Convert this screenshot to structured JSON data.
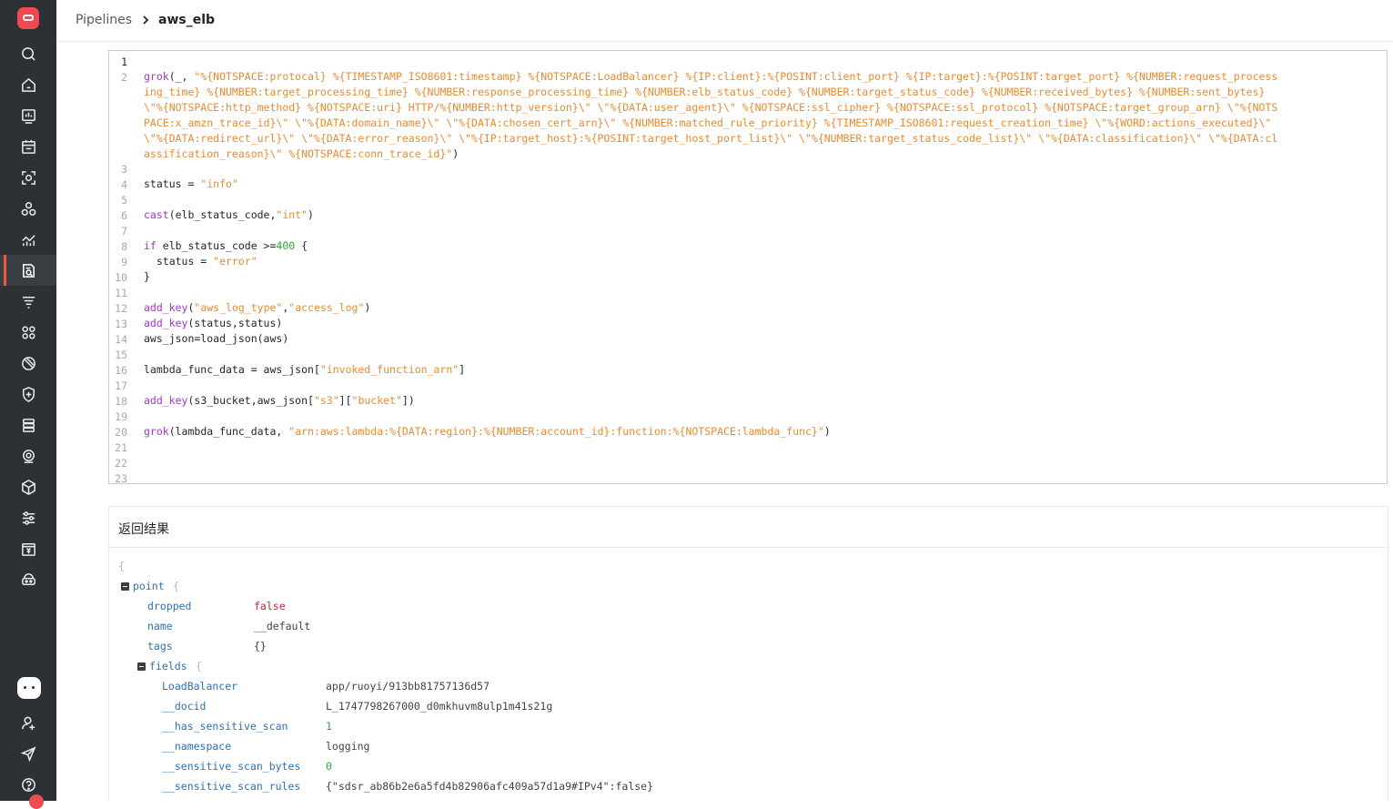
{
  "breadcrumb": {
    "root": "Pipelines",
    "current": "aws_elb"
  },
  "sidebar": {
    "active_item": "pipelines-icon",
    "icons": [
      "search-icon",
      "home-icon",
      "dashboard-icon",
      "calendar-icon",
      "scan-icon",
      "topology-icon",
      "metrics-icon",
      "pipelines-icon",
      "filter-icon",
      "apps-icon",
      "security-icon",
      "shield-icon",
      "database-icon",
      "monitor-icon",
      "package-icon",
      "settings-icon",
      "billing-icon",
      "integration-icon",
      "ai-assistant-icon",
      "user-icon",
      "send-icon",
      "help-icon"
    ]
  },
  "editor": {
    "line_numbers": [
      "1",
      "2",
      "3",
      "4",
      "5",
      "6",
      "7",
      "8",
      "9",
      "10",
      "11",
      "12",
      "13",
      "14",
      "15",
      "16",
      "17",
      "18",
      "19",
      "20",
      "21",
      "22",
      "23"
    ],
    "line2_text": "grok(_, \"%{NOTSPACE:protocal} %{TIMESTAMP_ISO8601:timestamp} %{NOTSPACE:LoadBalancer} %{IP:client}:%{POSINT:client_port} %{IP:target}:%{POSINT:target_port} %{NUMBER:request_processing_time} %{NUMBER:target_processing_time} %{NUMBER:response_processing_time} %{NUMBER:elb_status_code} %{NUMBER:target_status_code} %{NUMBER:received_bytes} %{NUMBER:sent_bytes} \\\"%{NOTSPACE:http_method} %{NOTSPACE:uri} HTTP/%{NUMBER:http_version}\\\" \\\"%{DATA:user_agent}\\\" %{NOTSPACE:ssl_cipher} %{NOTSPACE:ssl_protocol} %{NOTSPACE:target_group_arn} \\\"%{NOTSPACE:x_amzn_trace_id}\\\" \\\"%{DATA:domain_name}\\\" \\\"%{DATA:chosen_cert_arn}\\\" %{NUMBER:matched_rule_priority} %{TIMESTAMP_ISO8601:request_creation_time} \\\"%{WORD:actions_executed}\\\" \\\"%{DATA:redirect_url}\\\" \\\"%{DATA:error_reason}\\\" \\\"%{IP:target_host}:%{POSINT:target_host_port_list}\\\" \\\"%{NUMBER:target_status_code_list}\\\" \\\"%{DATA:classification}\\\" \\\"%{DATA:classification_reason}\\\" %{NOTSPACE:conn_trace_id}\")",
    "line2_wrapped": [
      "%{NOTSPACE:protocal} %{TIMESTAMP_ISO8601:timestamp} %{NOTSPACE:LoadBalancer} %{IP:client}:%{POSINT:client_port} %{IP:target}:%{POSINT:target_port} %{NUMBER:request_process",
      "ing_time} %{NUMBER:target_processing_time} %{NUMBER:response_processing_time} %{NUMBER:elb_status_code} %{NUMBER:target_status_code} %{NUMBER:received_bytes} %{NUMBER:sent_bytes}",
      "\\\"%{NOTSPACE:http_method} %{NOTSPACE:uri} HTTP/%{NUMBER:http_version}\\\" \\\"%{DATA:user_agent}\\\" %{NOTSPACE:ssl_cipher} %{NOTSPACE:ssl_protocol} %{NOTSPACE:target_group_arn} \\\"%{NOTS",
      "PACE:x_amzn_trace_id}\\\" \\\"%{DATA:domain_name}\\\" \\\"%{DATA:chosen_cert_arn}\\\" %{NUMBER:matched_rule_priority} %{TIMESTAMP_ISO8601:request_creation_time} \\\"%{WORD:actions_executed}\\\"",
      "\\\"%{DATA:redirect_url}\\\" \\\"%{DATA:error_reason}\\\" \\\"%{IP:target_host}:%{POSINT:target_host_port_list}\\\" \\\"%{NUMBER:target_status_code_list}\\\" \\\"%{DATA:classification}\\\" \\\"%{DATA:cl",
      "assification_reason}\\\" %{NOTSPACE:conn_trace_id}"
    ],
    "tokens": {
      "grok": "grok",
      "cast": "cast",
      "if": "if",
      "add_key": "add_key",
      "status_var": "status",
      "eq": " = ",
      "info": "\"info\"",
      "error": "\"error\"",
      "int": "\"int\"",
      "elb_status_code": "elb_status_code",
      "n400": "400",
      "aws_log_type": "\"aws_log_type\"",
      "access_log": "\"access_log\"",
      "aws_json_line": "aws_json=load_json(aws)",
      "lambda_var": "lambda_func_data = aws_json[",
      "invoked_function_arn": "\"invoked_function_arn\"",
      "s3": "\"s3\"",
      "bucket": "\"bucket\"",
      "arn_pattern": "\"arn:aws:lambda:%{DATA:region}:%{NUMBER:account_id}:function:%{NOTSPACE:lambda_func}\""
    }
  },
  "result": {
    "title": "返回结果",
    "point_key": "point",
    "fields_key": "fields",
    "point": [
      {
        "key": "dropped",
        "value": "false",
        "type": "bool"
      },
      {
        "key": "name",
        "value": "__default",
        "type": "str"
      },
      {
        "key": "tags",
        "value": "{}",
        "type": "str"
      }
    ],
    "fields": [
      {
        "key": "LoadBalancer",
        "value": "app/ruoyi/913bb81757136d57",
        "type": "str"
      },
      {
        "key": "__docid",
        "value": "L_1747798267000_d0mkhuvm8ulp1m41s21g",
        "type": "str"
      },
      {
        "key": "__has_sensitive_scan",
        "value": "1",
        "type": "num"
      },
      {
        "key": "__namespace",
        "value": "logging",
        "type": "str"
      },
      {
        "key": "__sensitive_scan_bytes",
        "value": "0",
        "type": "num"
      },
      {
        "key": "__sensitive_scan_rules",
        "value": "{\"sdsr_ab86b2e6a5fd4b82906afc409a57d1a9#IPv4\":false}",
        "type": "str"
      }
    ]
  }
}
